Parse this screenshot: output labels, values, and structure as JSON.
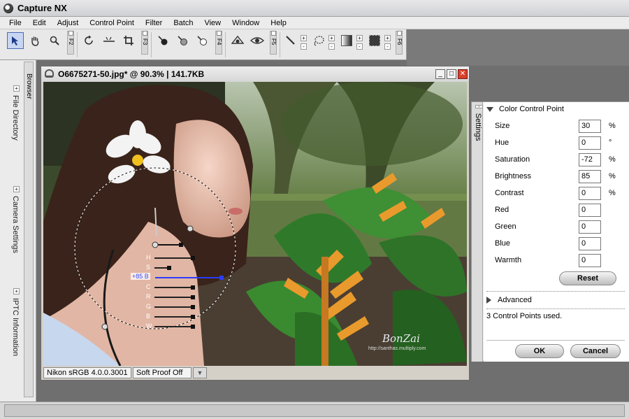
{
  "app": {
    "title": "Capture NX"
  },
  "menu": [
    "File",
    "Edit",
    "Adjust",
    "Control Point",
    "Filter",
    "Batch",
    "View",
    "Window",
    "Help"
  ],
  "toolbar": {
    "fkeys": [
      "F2",
      "F3",
      "F4",
      "F5",
      "F6"
    ],
    "tools": [
      "select-arrow-icon",
      "hand-icon",
      "zoom-icon",
      "rotate-icon",
      "straighten-icon",
      "crop-icon",
      "black-point-icon",
      "neutral-point-icon",
      "white-point-icon",
      "red-eye-icon",
      "eye-icon",
      "brush-icon",
      "lasso-icon",
      "gradient-icon",
      "fill-icon"
    ]
  },
  "dock": {
    "tabs": [
      "File Directory",
      "Camera Settings",
      "IPTC Information"
    ],
    "browser": "Browser"
  },
  "image_window": {
    "title": "O6675271-50.jpg* @ 90.3% | 141.7KB",
    "profile": "Nikon sRGB 4.0.0.3001",
    "soft_proof": "Soft Proof Off",
    "watermark": "BonZai",
    "watermark_url": "http://santhas.multiply.com",
    "control_point": {
      "active_value": "+85 B",
      "sliders": [
        "H",
        "S",
        "B",
        "C",
        "R",
        "G",
        "B",
        "W"
      ],
      "active_index": 2
    }
  },
  "settings": {
    "tab": "Settings",
    "section_title": "Color Control Point",
    "params": [
      {
        "label": "Size",
        "value": "30",
        "unit": "%"
      },
      {
        "label": "Hue",
        "value": "0",
        "unit": "°"
      },
      {
        "label": "Saturation",
        "value": "-72",
        "unit": "%"
      },
      {
        "label": "Brightness",
        "value": "85",
        "unit": "%"
      },
      {
        "label": "Contrast",
        "value": "0",
        "unit": "%"
      },
      {
        "label": "Red",
        "value": "0",
        "unit": ""
      },
      {
        "label": "Green",
        "value": "0",
        "unit": ""
      },
      {
        "label": "Blue",
        "value": "0",
        "unit": ""
      },
      {
        "label": "Warmth",
        "value": "0",
        "unit": ""
      }
    ],
    "reset_label": "Reset",
    "advanced_label": "Advanced",
    "status": "3 Control Points used.",
    "ok_label": "OK",
    "cancel_label": "Cancel"
  }
}
